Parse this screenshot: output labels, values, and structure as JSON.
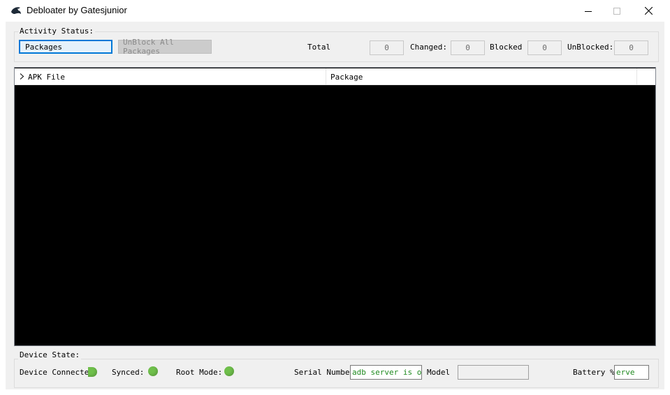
{
  "window": {
    "title": "Debloater by Gatesjunior",
    "icon": "fish-icon",
    "controls": [
      "minimize",
      "maximize",
      "close"
    ]
  },
  "activity_status": {
    "label": "Activity Status:",
    "packages_button": "Packages",
    "unblock_all_button": "UnBlock All Packages",
    "total_label": "Total",
    "total_value": "0",
    "changed_label": "Changed:",
    "changed_value": "0",
    "blocked_label": "Blocked",
    "blocked_value": "0",
    "unblocked_label": "UnBlocked:",
    "unblocked_value": "0"
  },
  "list": {
    "columns": [
      "APK File",
      "Package"
    ],
    "rows": []
  },
  "device_state": {
    "label": "Device State:",
    "device_connected_label": "Device Connected:",
    "synced_label": "Synced:",
    "root_mode_label": "Root Mode:",
    "serial_number_label": "Serial Number:",
    "serial_number_value": "adb server is ou",
    "model_label": "Model",
    "model_value": "",
    "battery_label": "Battery %:",
    "battery_value": "erve",
    "indicator_color": "#6fbf4b"
  }
}
